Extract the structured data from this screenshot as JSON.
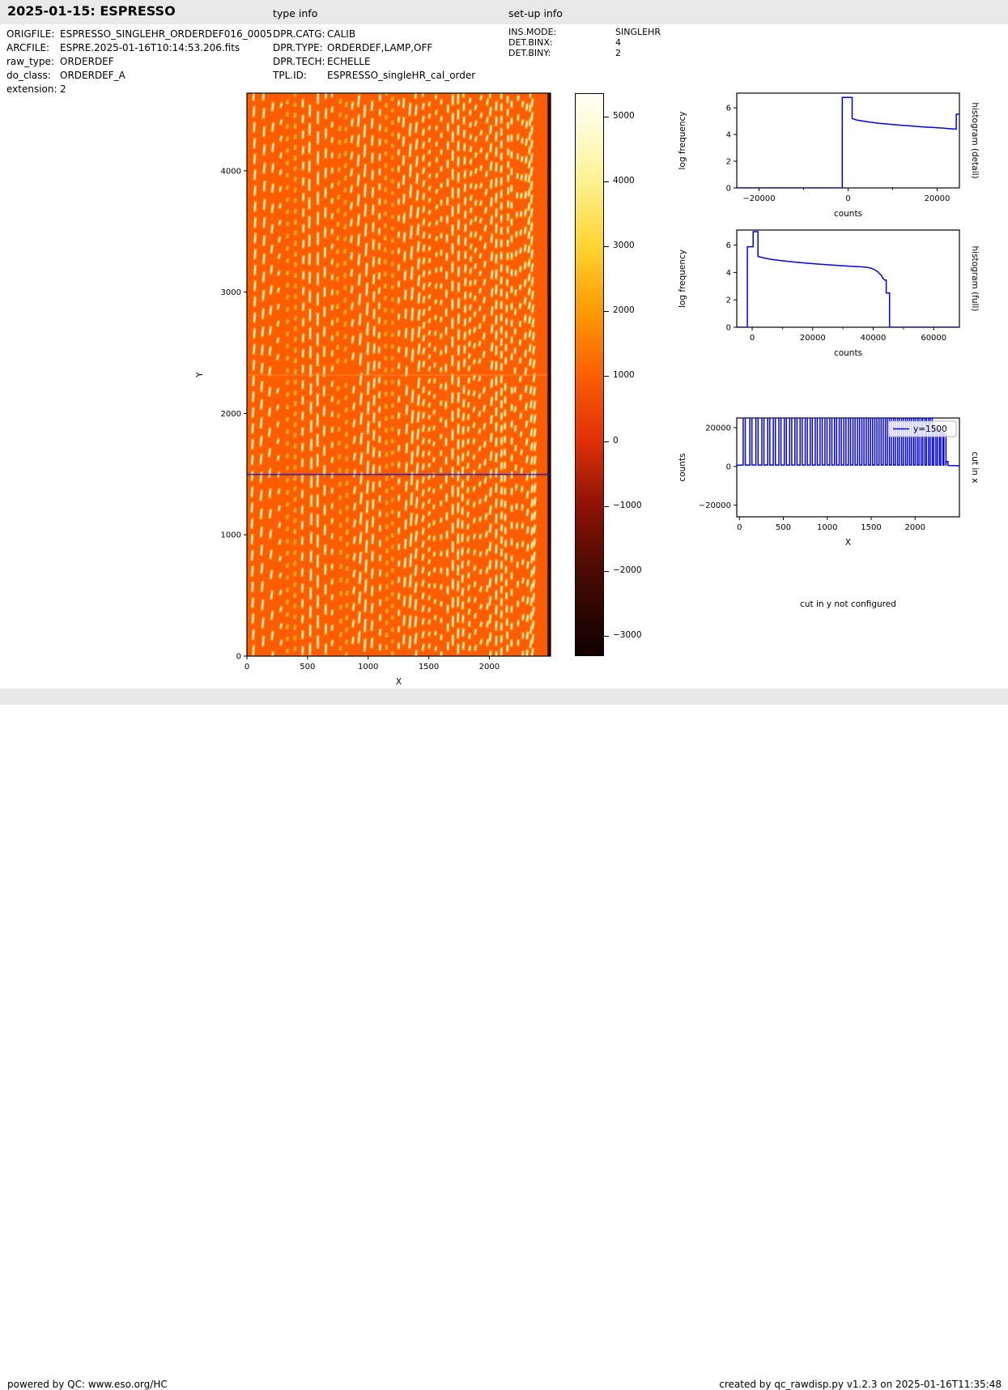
{
  "header": {
    "title": "2025-01-15: ESPRESSO",
    "type_info_label": "type info",
    "setup_info_label": "set-up info"
  },
  "file_info": {
    "rows": [
      {
        "label": "ORIGFILE:",
        "value": "ESPRESSO_SINGLEHR_ORDERDEF016_0005"
      },
      {
        "label": "ARCFILE:",
        "value": "ESPRE.2025-01-16T10:14:53.206.fits"
      },
      {
        "label": "raw_type:",
        "value": "ORDERDEF"
      },
      {
        "label": "do_class:",
        "value": "ORDERDEF_A"
      },
      {
        "label": "extension:",
        "value": "2"
      }
    ]
  },
  "type_info": {
    "rows": [
      {
        "label": "DPR.CATG:",
        "value": "CALIB"
      },
      {
        "label": "DPR.TYPE:",
        "value": "ORDERDEF,LAMP,OFF"
      },
      {
        "label": "DPR.TECH:",
        "value": "ECHELLE"
      },
      {
        "label": "TPL.ID:",
        "value": "ESPRESSO_singleHR_cal_order"
      }
    ]
  },
  "setup_info": {
    "rows": [
      {
        "label": "INS.MODE:",
        "value": "SINGLEHR"
      },
      {
        "label": "DET.BINX:",
        "value": "4"
      },
      {
        "label": "DET.BINY:",
        "value": "2"
      }
    ]
  },
  "notes": {
    "cut_y": "cut in y not configured"
  },
  "footer": {
    "left": "powered by QC: www.eso.org/HC",
    "right": "created by qc_rawdisp.py v1.2.3 on 2025-01-16T11:35:48"
  },
  "colors": {
    "series_blue": "#0000ee",
    "cut_line_blue": "#1d1dc0",
    "image_background_orange": "#fc5d03",
    "header_bar_gray": "#e9e9e9",
    "order_dash_white": "#ffffff",
    "order_halo_yellow": "#ffbe1e"
  },
  "colorbar": {
    "vmin": -3312,
    "vmax": 5360,
    "ticks": [
      5000,
      4000,
      3000,
      2000,
      1000,
      0,
      -1000,
      -2000,
      -3000
    ],
    "stops": [
      {
        "pos": 0,
        "color": "#fffff4"
      },
      {
        "pos": 4.2,
        "color": "#fffce1"
      },
      {
        "pos": 15.7,
        "color": "#fdf290"
      },
      {
        "pos": 27.2,
        "color": "#fdd431"
      },
      {
        "pos": 38.7,
        "color": "#fc9a04"
      },
      {
        "pos": 50.3,
        "color": "#fb5e02"
      },
      {
        "pos": 61.8,
        "color": "#e03008"
      },
      {
        "pos": 73.3,
        "color": "#8e1205"
      },
      {
        "pos": 84.9,
        "color": "#4b0a02"
      },
      {
        "pos": 96.4,
        "color": "#1d0301"
      },
      {
        "pos": 100,
        "color": "#140101"
      }
    ]
  },
  "chart_data": [
    {
      "type": "heatmap",
      "name": "raw-image",
      "title": "",
      "xlabel": "X",
      "ylabel": "Y",
      "xlim": [
        0,
        2505
      ],
      "ylim": [
        0,
        4640
      ],
      "xticks": [
        0,
        500,
        1000,
        1500,
        2000
      ],
      "yticks": [
        0,
        1000,
        2000,
        3000,
        4000
      ],
      "cut_line_y": 1500,
      "detector_gap_y": 2320,
      "dark_right_edge_x": 2480,
      "description": "orange raw echelle frame, ~45 dashed white-yellow vertical order traces, blue cut line at Y=1500"
    },
    {
      "type": "line",
      "name": "histogram-detail",
      "title": "histogram (detail)",
      "xlabel": "counts",
      "ylabel": "log frequency",
      "xlim": [
        -25000,
        25000
      ],
      "ylim": [
        0,
        7.1
      ],
      "xticks": [
        -20000,
        0,
        20000
      ],
      "xminor": [
        -10000,
        10000
      ],
      "yticks": [
        0,
        2,
        4,
        6
      ],
      "points": [
        [
          -25000,
          0
        ],
        [
          -1300,
          0
        ],
        [
          -1300,
          6.78
        ],
        [
          900,
          6.78
        ],
        [
          900,
          5.2
        ],
        [
          2000,
          5.08
        ],
        [
          3500,
          5.0
        ],
        [
          5000,
          4.92
        ],
        [
          7000,
          4.84
        ],
        [
          9000,
          4.78
        ],
        [
          11000,
          4.72
        ],
        [
          13000,
          4.67
        ],
        [
          15000,
          4.62
        ],
        [
          17000,
          4.57
        ],
        [
          19000,
          4.53
        ],
        [
          21000,
          4.49
        ],
        [
          22500,
          4.45
        ],
        [
          23800,
          4.42
        ],
        [
          24300,
          4.4
        ],
        [
          24300,
          5.52
        ],
        [
          24900,
          5.52
        ]
      ]
    },
    {
      "type": "line",
      "name": "histogram-full",
      "title": "histogram (full)",
      "xlabel": "counts",
      "ylabel": "log frequency",
      "xlim": [
        -5100,
        68500
      ],
      "ylim": [
        0,
        7.1
      ],
      "xticks": [
        0,
        20000,
        40000,
        60000
      ],
      "xminor": [
        10000,
        30000,
        50000
      ],
      "yticks": [
        0,
        2,
        4,
        6
      ],
      "points": [
        [
          -5100,
          0
        ],
        [
          -1600,
          0
        ],
        [
          -1600,
          5.88
        ],
        [
          300,
          5.88
        ],
        [
          300,
          6.98
        ],
        [
          1900,
          6.98
        ],
        [
          1900,
          5.18
        ],
        [
          3500,
          5.08
        ],
        [
          6000,
          4.97
        ],
        [
          9000,
          4.88
        ],
        [
          12000,
          4.81
        ],
        [
          15000,
          4.74
        ],
        [
          18000,
          4.68
        ],
        [
          21000,
          4.63
        ],
        [
          24000,
          4.58
        ],
        [
          27000,
          4.53
        ],
        [
          30000,
          4.49
        ],
        [
          33000,
          4.45
        ],
        [
          35500,
          4.42
        ],
        [
          38000,
          4.38
        ],
        [
          39500,
          4.3
        ],
        [
          40500,
          4.2
        ],
        [
          41500,
          4.05
        ],
        [
          42200,
          3.9
        ],
        [
          42800,
          3.75
        ],
        [
          43300,
          3.55
        ],
        [
          43800,
          3.45
        ],
        [
          44300,
          3.45
        ],
        [
          44300,
          2.5
        ],
        [
          45400,
          2.5
        ],
        [
          45400,
          0
        ],
        [
          68000,
          0
        ]
      ]
    },
    {
      "type": "line",
      "name": "cut-in-x",
      "title": "cut in x",
      "legend": "y=1500",
      "xlabel": "X",
      "ylabel": "counts",
      "xlim": [
        -30,
        2505
      ],
      "ylim": [
        -26000,
        25000
      ],
      "xticks": [
        0,
        500,
        1000,
        1500,
        2000
      ],
      "yticks": [
        -20000,
        0,
        20000
      ],
      "baseline": 700,
      "spike_halfwidth": 12,
      "spikes": [
        [
          55,
          26000
        ],
        [
          130,
          26000
        ],
        [
          200,
          26000
        ],
        [
          268,
          26000
        ],
        [
          334,
          26000
        ],
        [
          398,
          26000
        ],
        [
          461,
          26000
        ],
        [
          523,
          26000
        ],
        [
          584,
          26000
        ],
        [
          644,
          26000
        ],
        [
          703,
          26000
        ],
        [
          761,
          26000
        ],
        [
          818,
          26000
        ],
        [
          875,
          26000
        ],
        [
          931,
          26000
        ],
        [
          986,
          26000
        ],
        [
          1041,
          26000
        ],
        [
          1095,
          26000
        ],
        [
          1148,
          26000
        ],
        [
          1201,
          26000
        ],
        [
          1253,
          26000
        ],
        [
          1305,
          26000
        ],
        [
          1356,
          26000
        ],
        [
          1406,
          26000
        ],
        [
          1456,
          26000
        ],
        [
          1505,
          26000
        ],
        [
          1554,
          26000
        ],
        [
          1602,
          26000
        ],
        [
          1650,
          26000
        ],
        [
          1697,
          26000
        ],
        [
          1744,
          26000
        ],
        [
          1790,
          26000
        ],
        [
          1836,
          26000
        ],
        [
          1881,
          26000
        ],
        [
          1926,
          26000
        ],
        [
          1970,
          26000
        ],
        [
          2014,
          26000
        ],
        [
          2057,
          26000
        ],
        [
          2100,
          26000
        ],
        [
          2142,
          26000
        ],
        [
          2184,
          25000
        ],
        [
          2225,
          21000
        ],
        [
          2266,
          19000
        ],
        [
          2306,
          17500
        ],
        [
          2340,
          17000
        ],
        [
          2362,
          2500
        ]
      ]
    }
  ]
}
